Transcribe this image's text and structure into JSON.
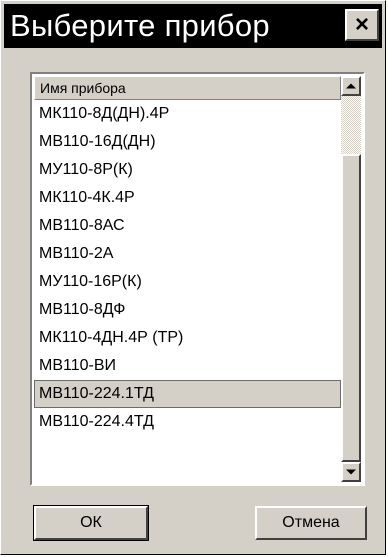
{
  "dialog": {
    "title": "Выберите прибор",
    "close_label": "×"
  },
  "list": {
    "header": "Имя прибора",
    "items": [
      "МК110-8Д(ДН).4Р",
      "МВ110-16Д(ДН)",
      "МУ110-8Р(К)",
      "МК110-4К.4Р",
      "МВ110-8АС",
      "МВ110-2А",
      "МУ110-16Р(К)",
      "МВ110-8ДФ",
      "МК110-4ДН.4Р (ТР)",
      "МВ110-ВИ",
      "МВ110-224.1ТД",
      "МВ110-224.4ТД"
    ],
    "selected_item": "МВ110-224.1ТД"
  },
  "buttons": {
    "ok_label": "ОК",
    "cancel_label": "Отмена"
  }
}
